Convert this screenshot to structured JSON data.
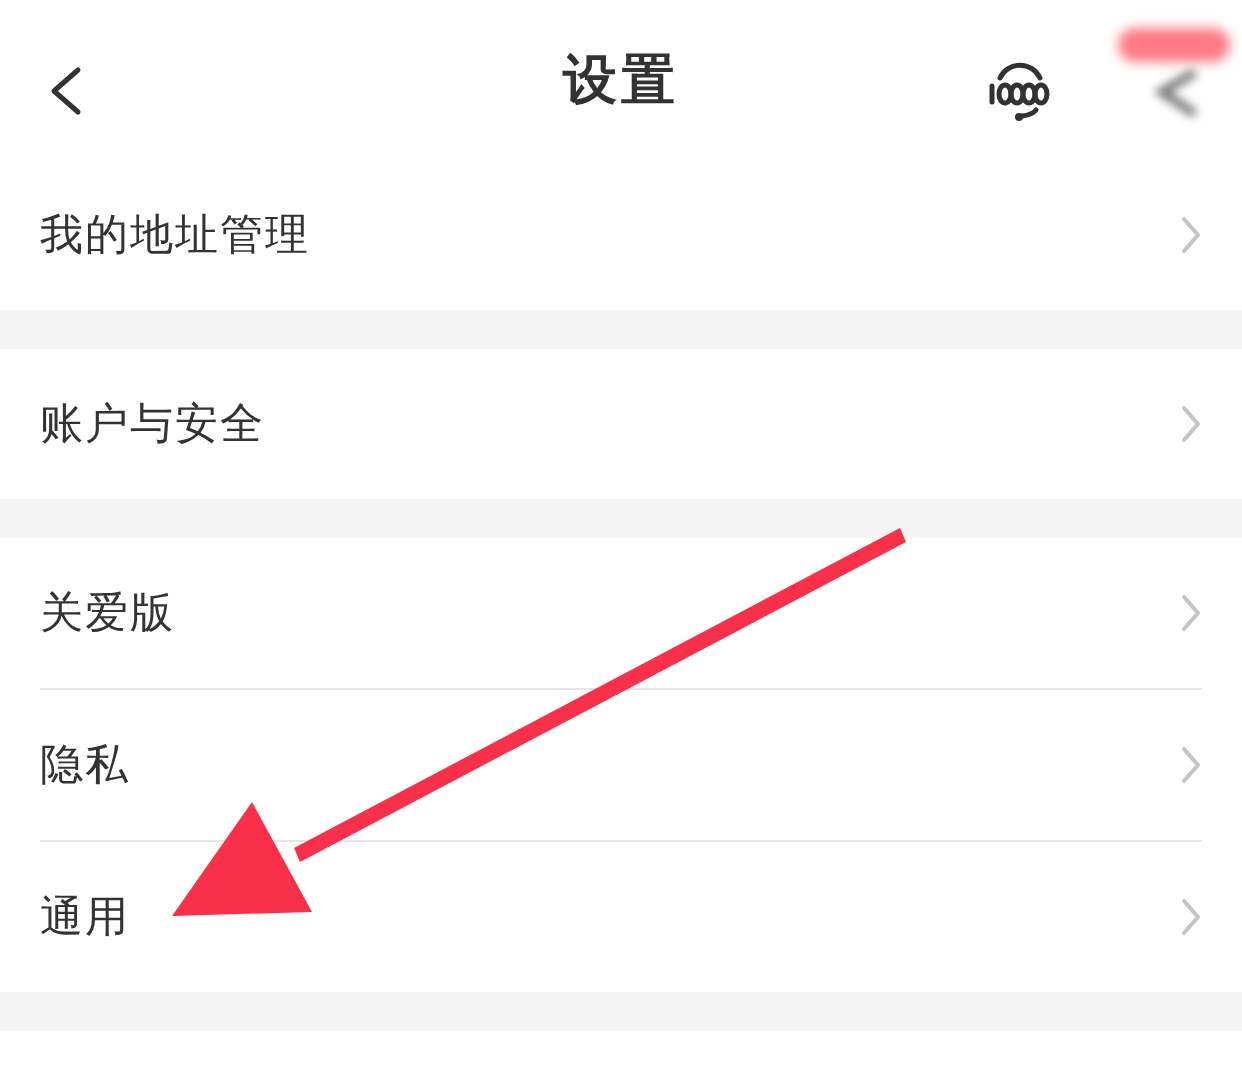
{
  "header": {
    "title": "设置"
  },
  "sections": [
    {
      "items": [
        {
          "label": "我的地址管理"
        }
      ]
    },
    {
      "items": [
        {
          "label": "账户与安全"
        }
      ]
    },
    {
      "items": [
        {
          "label": "关爱版"
        },
        {
          "label": "隐私"
        },
        {
          "label": "通用"
        }
      ]
    }
  ]
}
